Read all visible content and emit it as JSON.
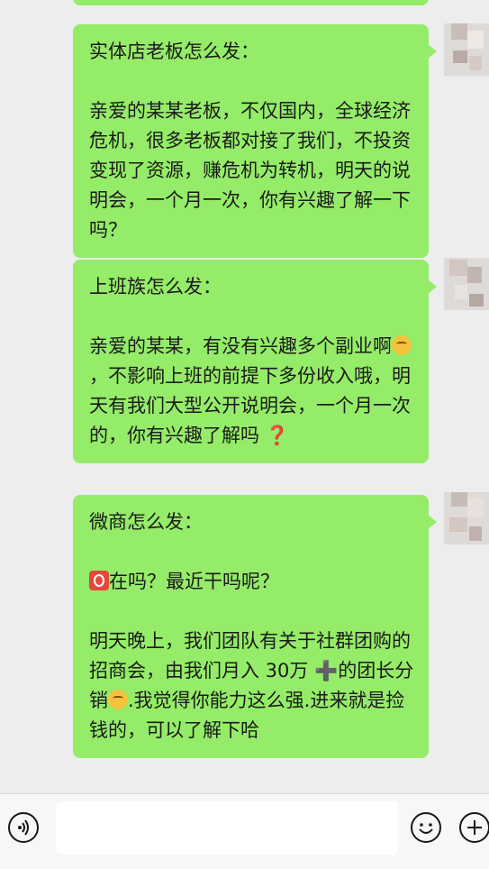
{
  "messages": [
    {
      "lines": []
    },
    {
      "title": "实体店老板怎么发：",
      "body": "亲爱的某某老板，不仅国内，全球经济危机，很多老板都对接了我们，不投资变现了资源，赚危机为转机，明天的说明会，一个月一次，你有兴趣了解一下吗？"
    },
    {
      "title": "上班族怎么发：",
      "body_part1": "亲爱的某某，有没有兴趣多个副业啊",
      "body_part2": "，不影响上班的前提下多份收入哦，明天有我们大型公开说明会，一个月一次的，你有兴趣了解吗",
      "q_mark": "❓"
    },
    {
      "title": "微商怎么发：",
      "line2": "在吗？最近干吗呢？",
      "body_part1": "明天晚上，我们团队有关于社群团购的招商会，由我们月入 30万",
      "plus": "➕",
      "body_part2": "的团长分销",
      "body_part3": ".我觉得你能力这么强.进来就是捡钱的，可以了解下哈"
    }
  ],
  "icons": {
    "voice": "voice-icon",
    "emoji": "emoji-icon",
    "plus": "plus-icon",
    "thinking_emoji": "thinking-face-emoji",
    "red_o": "red-o-emoji"
  },
  "colors": {
    "bubble": "#95ec69",
    "background": "#ededed",
    "input_bar": "#f7f7f7"
  }
}
